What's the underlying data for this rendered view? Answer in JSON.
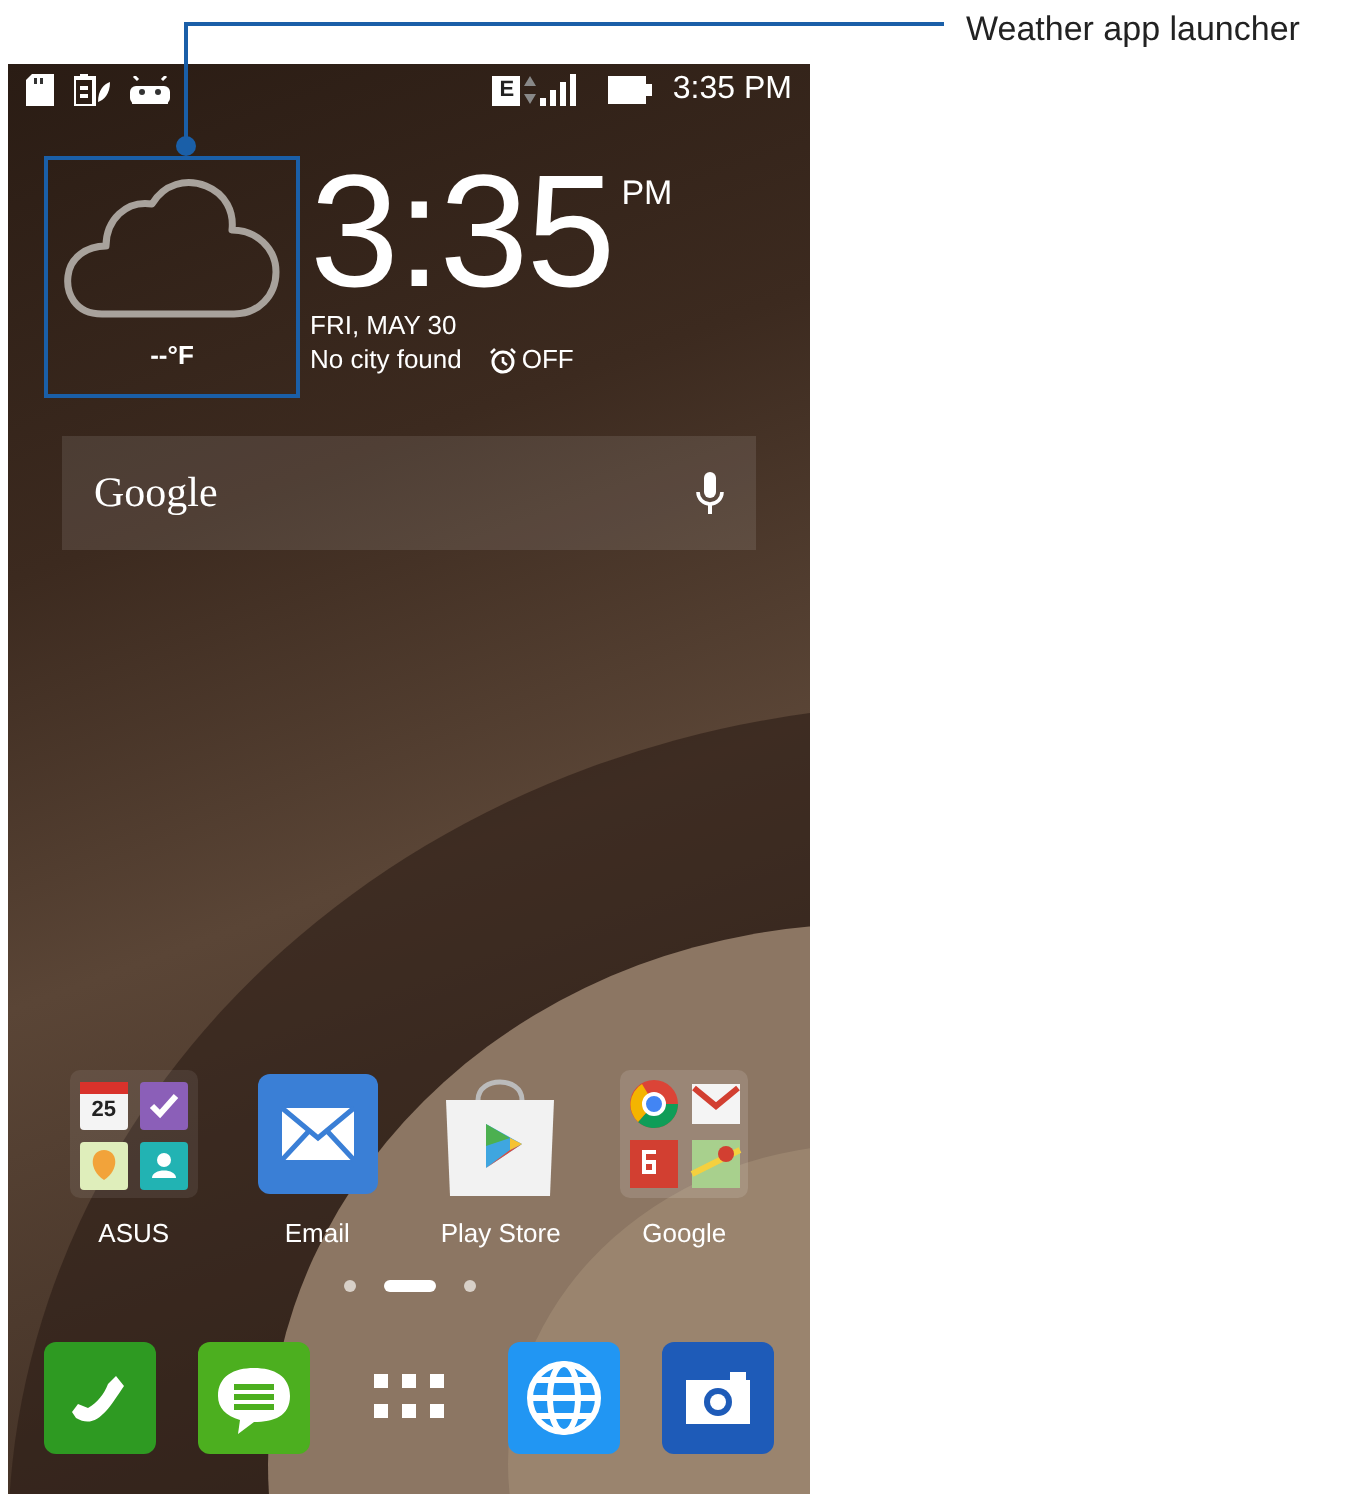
{
  "callout": {
    "label": "Weather app launcher"
  },
  "status_bar": {
    "network": "E",
    "time": "3:35 PM"
  },
  "weather": {
    "temperature": "--°F"
  },
  "clock": {
    "time": "3:35",
    "period": "PM",
    "date": "FRI, MAY 30",
    "city": "No city found",
    "alarm": "OFF"
  },
  "search": {
    "logo": "Google"
  },
  "apps": [
    {
      "kind": "asus-folder",
      "label": "ASUS",
      "calendar_day": "25"
    },
    {
      "kind": "email",
      "label": "Email"
    },
    {
      "kind": "store",
      "label": "Play Store"
    },
    {
      "kind": "google-folder",
      "label": "Google"
    }
  ],
  "page_dots": [
    {
      "selected": false
    },
    {
      "selected": true
    },
    {
      "selected": false
    }
  ],
  "dock": [
    {
      "kind": "phone"
    },
    {
      "kind": "messages"
    },
    {
      "kind": "apps"
    },
    {
      "kind": "browser"
    },
    {
      "kind": "camera"
    }
  ]
}
